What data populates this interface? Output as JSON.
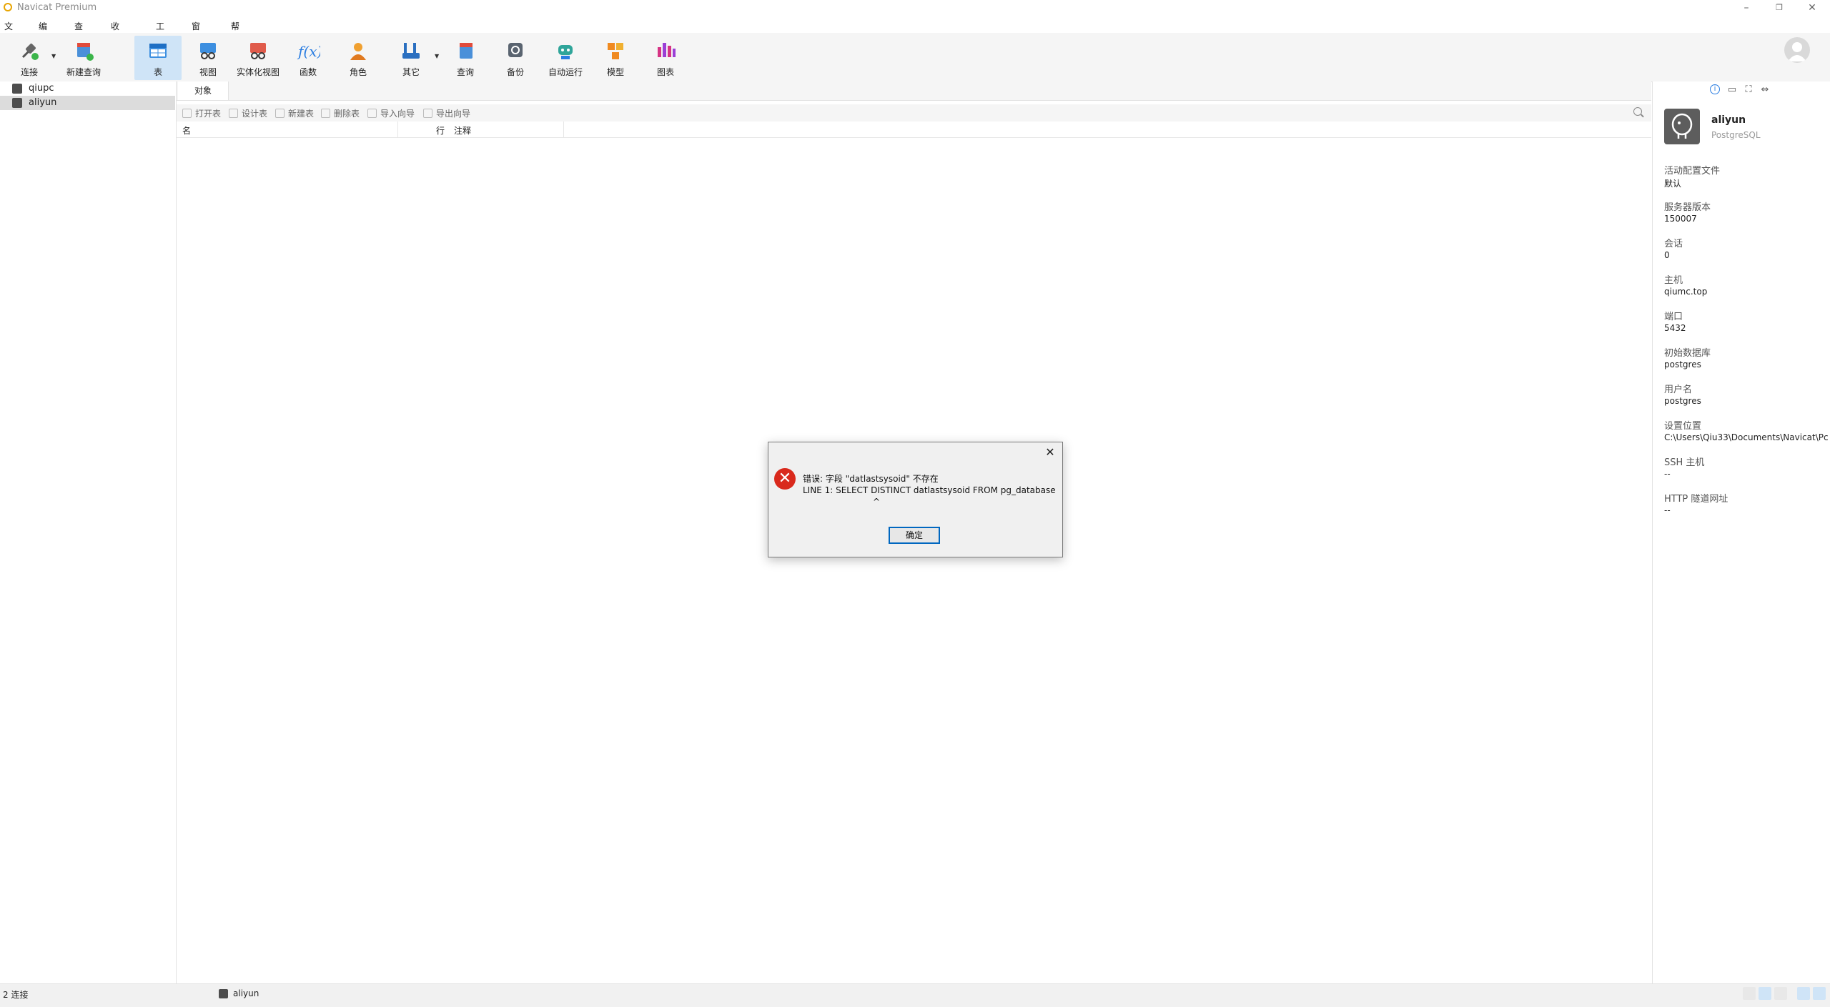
{
  "window": {
    "title": "Navicat Premium"
  },
  "menu": [
    "文件",
    "编辑",
    "查看",
    "收藏夹",
    "工具",
    "窗口",
    "帮助"
  ],
  "toolbar": {
    "connect": "连接",
    "new_query": "新建查询",
    "table": "表",
    "view": "视图",
    "mat_view": "实体化视图",
    "function": "函数",
    "role": "角色",
    "other": "其它",
    "query": "查询",
    "backup": "备份",
    "automation": "自动运行",
    "model": "模型",
    "chart": "图表"
  },
  "tree": {
    "connections": [
      "qiupc",
      "aliyun"
    ]
  },
  "objects": {
    "tab": "对象",
    "open_table": "打开表",
    "design_table": "设计表",
    "new_table": "新建表",
    "delete_table": "删除表",
    "import_wizard": "导入向导",
    "export_wizard": "导出向导",
    "col_name": "名",
    "col_rows": "行",
    "col_comment": "注释"
  },
  "info": {
    "name": "aliyun",
    "type": "PostgreSQL",
    "props": [
      {
        "label": "活动配置文件",
        "value": "默认"
      },
      {
        "label": "服务器版本",
        "value": "150007"
      },
      {
        "label": "会话",
        "value": "0"
      },
      {
        "label": "主机",
        "value": "qiumc.top"
      },
      {
        "label": "端口",
        "value": "5432"
      },
      {
        "label": "初始数据库",
        "value": "postgres"
      },
      {
        "label": "用户名",
        "value": "postgres"
      },
      {
        "label": "设置位置",
        "value": "C:\\Users\\Qiu33\\Documents\\Navicat\\Pc"
      },
      {
        "label": "SSH 主机",
        "value": "--"
      },
      {
        "label": "HTTP 隧道网址",
        "value": "--"
      }
    ]
  },
  "status": {
    "count": "2 连接",
    "connection": "aliyun"
  },
  "dialog": {
    "line1": "错误: 字段 \"datlastsysoid\" 不存在",
    "line2": "LINE 1: SELECT DISTINCT datlastsysoid FROM pg_database",
    "line3": "^",
    "ok": "确定"
  },
  "colors": {
    "accent": "#2a7de1",
    "selected_tool": "#cfe4f7",
    "error": "#d9291c"
  }
}
